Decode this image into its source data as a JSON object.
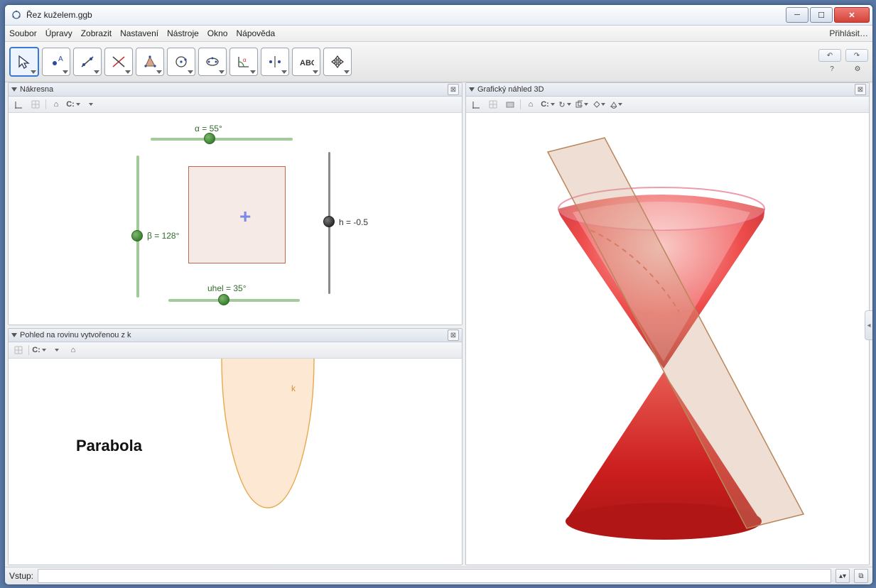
{
  "window": {
    "title": "Řez kuželem.ggb"
  },
  "menu": {
    "file": "Soubor",
    "edit": "Úpravy",
    "view": "Zobrazit",
    "options": "Nastavení",
    "tools": "Nástroje",
    "window": "Okno",
    "help": "Nápověda",
    "signin": "Přihlásit…"
  },
  "panels": {
    "graphics": "Nákresna",
    "planeview": "Pohled na rovinu vytvořenou z k",
    "view3d": "Grafický náhled 3D"
  },
  "sliders": {
    "alpha": {
      "label": "α = 55°",
      "value": 55
    },
    "beta": {
      "label": "β = 128°",
      "value": 128
    },
    "uhel": {
      "label": "uhel = 35°",
      "value": 35
    },
    "h": {
      "label": "h = -0.5",
      "value": -0.5
    }
  },
  "curve": {
    "name": "k",
    "type_label": "Parabola"
  },
  "inputbar": {
    "label": "Vstup:",
    "value": ""
  }
}
